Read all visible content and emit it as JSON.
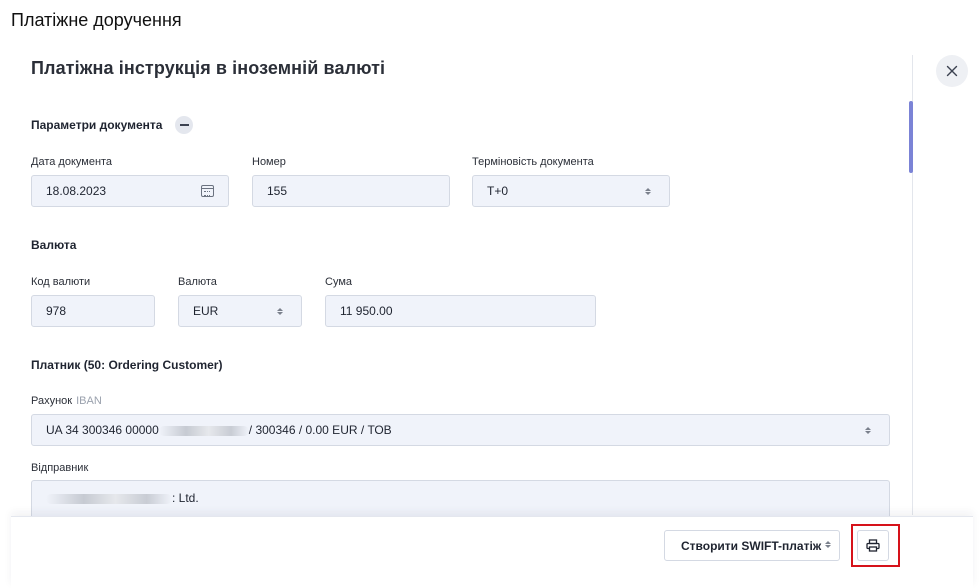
{
  "page": {
    "title": "Платіжне доручення"
  },
  "modal": {
    "title": "Платіжна інструкція в іноземній валюті",
    "sections": {
      "document_params": {
        "title": "Параметри документа",
        "date_label": "Дата документа",
        "date_value": "18.08.2023",
        "number_label": "Номер",
        "number_value": "155",
        "urgency_label": "Терміновість документа",
        "urgency_value": "T+0"
      },
      "currency": {
        "title": "Валюта",
        "code_label": "Код валюти",
        "code_value": "978",
        "currency_label": "Валюта",
        "currency_value": "EUR",
        "amount_label": "Сума",
        "amount_value": "11 950.00"
      },
      "payer": {
        "title": "Платник (50: Ordering Customer)",
        "account_label": "Рахунок",
        "account_hint": "IBAN",
        "account_prefix": "UA 34 300346 00000",
        "account_suffix": "/ 300346 / 0.00 EUR / ТОВ",
        "sender_label": "Відправник",
        "sender_suffix": ": Ltd."
      }
    }
  },
  "footer": {
    "create_swift_label": "Створити SWIFT-платіж"
  },
  "icons": {
    "close": "close-icon",
    "calendar": "calendar-icon",
    "print": "print-icon",
    "updown": "sort-updown-icon",
    "collapse": "minus-icon"
  },
  "colors": {
    "field_bg": "#f0f3fa",
    "scroll_thumb": "#7b83d6",
    "highlight": "#d6121a"
  }
}
